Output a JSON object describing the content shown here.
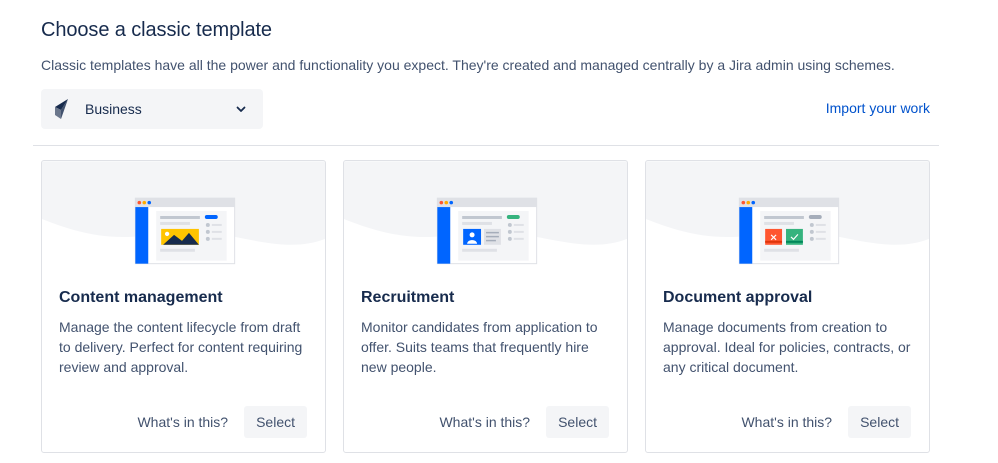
{
  "header": {
    "title": "Choose a classic template",
    "description": "Classic templates have all the power and functionality you expect. They're created and managed centrally by a Jira admin using schemes."
  },
  "category_select": {
    "selected": "Business",
    "icon": "business-category-icon"
  },
  "import_link": "Import your work",
  "colors": {
    "link": "#0052cc",
    "sidebar_blue": "#0065ff",
    "accent_yellow": "#ffc400",
    "accent_green": "#36b37e",
    "accent_red": "#ff5630"
  },
  "templates": [
    {
      "title": "Content management",
      "description": "Manage the content lifecycle from draft to delivery. Perfect for content requiring review and approval.",
      "whats_in": "What's in this?",
      "select": "Select"
    },
    {
      "title": "Recruitment",
      "description": "Monitor candidates from application to offer. Suits teams that frequently hire new people.",
      "whats_in": "What's in this?",
      "select": "Select"
    },
    {
      "title": "Document approval",
      "description": "Manage documents from creation to approval. Ideal for policies, contracts, or any critical document.",
      "whats_in": "What's in this?",
      "select": "Select"
    }
  ]
}
